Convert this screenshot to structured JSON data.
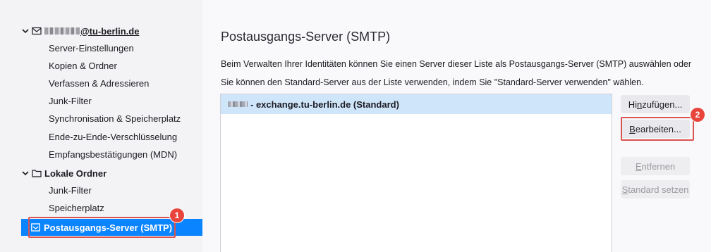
{
  "sidebar": {
    "account": {
      "email_suffix": "@tu-berlin.de",
      "icon": "envelope-icon"
    },
    "account_items": [
      "Server-Einstellungen",
      "Kopien & Ordner",
      "Verfassen & Adressieren",
      "Junk-Filter",
      "Synchronisation & Speicherplatz",
      "Ende-zu-Ende-Verschlüsselung",
      "Empfangsbestätigungen (MDN)"
    ],
    "local_folders": {
      "label": "Lokale Ordner",
      "icon": "folder-icon"
    },
    "local_items": [
      "Junk-Filter",
      "Speicherplatz"
    ],
    "selected": {
      "label": "Postausgangs-Server (SMTP)",
      "icon": "outbox-icon"
    }
  },
  "main": {
    "title": "Postausgangs-Server (SMTP)",
    "description": "Beim Verwalten Ihrer Identitäten können Sie einen Server dieser Liste als Postausgangs-Server (SMTP) auswählen oder Sie können den Standard-Server aus der Liste verwenden, indem Sie \"Standard-Server verwenden\" wählen.",
    "server_list": [
      {
        "label": " - exchange.tu-berlin.de (Standard)"
      }
    ],
    "buttons": {
      "add": {
        "pre": "Hi",
        "key": "n",
        "post": "zufügen..."
      },
      "edit": {
        "pre": "",
        "key": "B",
        "post": "earbeiten..."
      },
      "remove": {
        "pre": "",
        "key": "E",
        "post": "ntfernen"
      },
      "set_default": {
        "pre": "",
        "key": "S",
        "post": "tandard setzen"
      }
    }
  },
  "callouts": {
    "one": "1",
    "two": "2"
  },
  "colors": {
    "selection": "#0a84ff",
    "list_selection": "#cfe6fa",
    "callout": "#e8453c"
  }
}
